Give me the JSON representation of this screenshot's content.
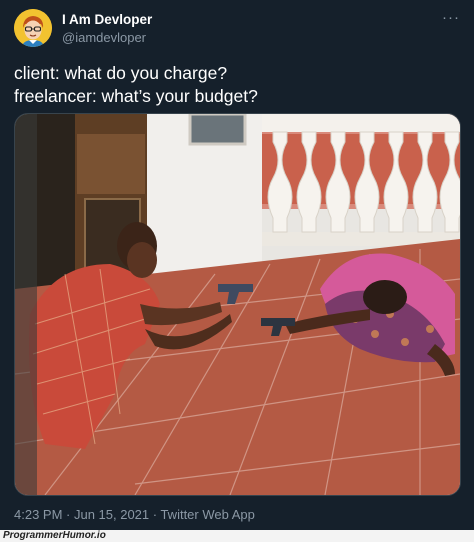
{
  "tweet": {
    "author_name": "I Am Devloper",
    "author_handle": "@iamdevloper",
    "more_icon": "more-horizontal-icon",
    "text": "client: what do you charge?\nfreelancer: what’s your budget?",
    "timestamp": "4:23 PM · Jun 15, 2021 · Twitter Web App",
    "media_alt": ""
  },
  "footer": {
    "watermark": "ProgrammerHumor.io"
  },
  "colors": {
    "background": "#15202b",
    "text_primary": "#ffffff",
    "text_secondary": "#8b98a5",
    "avatar_bg": "#f2c230"
  }
}
